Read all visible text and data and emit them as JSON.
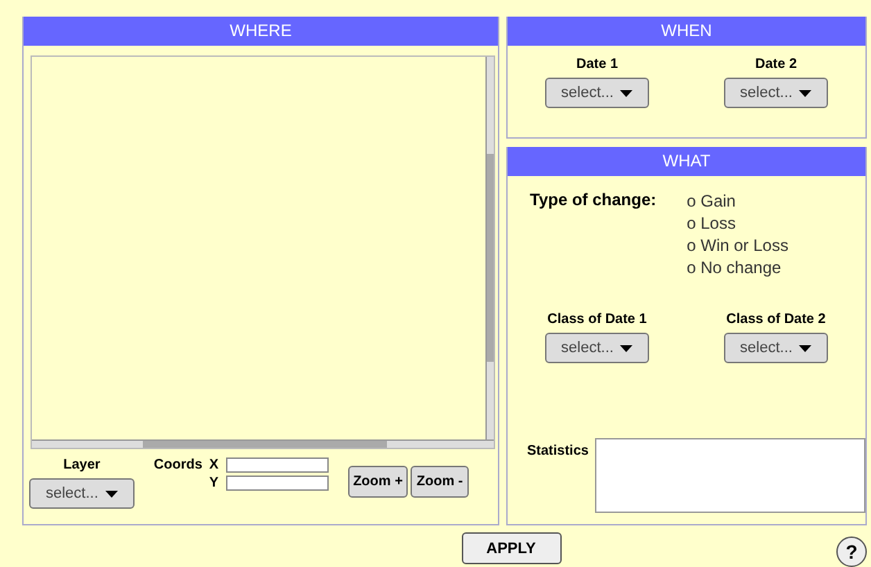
{
  "where": {
    "title": "WHERE",
    "layer": {
      "label": "Layer",
      "select": "select..."
    },
    "coords": {
      "label": "Coords",
      "x_label": "X",
      "y_label": "Y"
    },
    "zoom_buttons": [
      "Zoom +",
      "Zoom -"
    ]
  },
  "when": {
    "title": "WHEN",
    "dates": [
      {
        "label": "Date 1",
        "select": "select..."
      },
      {
        "label": "Date 2",
        "select": "select..."
      }
    ]
  },
  "what": {
    "title": "WHAT",
    "type_label": "Type of change:",
    "options": [
      "o Gain",
      "o Loss",
      "o Win or Loss",
      "o No change"
    ],
    "classes": [
      {
        "label": "Class of Date 1",
        "select": "select..."
      },
      {
        "label": "Class of Date 2",
        "select": "select..."
      }
    ],
    "statistics_label": "Statistics"
  },
  "apply": "APPLY",
  "help": "?"
}
